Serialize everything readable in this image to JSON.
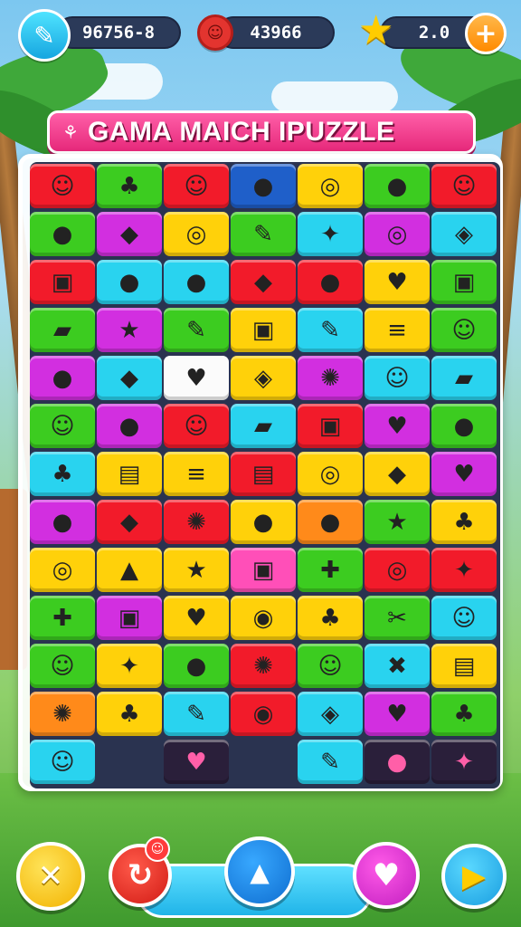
{
  "hud": {
    "score_text": "96756-8",
    "coins_text": "43966",
    "stars_text": "2.0",
    "add_label": "+"
  },
  "title": {
    "glyph": "⚘",
    "text": "GAMA MAICH IPUZZLE"
  },
  "colors": {
    "red": "#f21b2a",
    "green": "#3ccc20",
    "yellow": "#ffd10a",
    "cyan": "#29d3ef",
    "magenta": "#d22fe0",
    "pink": "#ff4fb8",
    "blue": "#1f5fc9",
    "orange": "#ff8a1a",
    "white": "#fbfbfb",
    "dark": "#2a1f3a"
  },
  "board": {
    "rows": [
      [
        {
          "c": "red",
          "i": "☺"
        },
        {
          "c": "green",
          "i": "♣"
        },
        {
          "c": "red",
          "i": "☺"
        },
        {
          "c": "blue",
          "i": "●"
        },
        {
          "c": "yellow",
          "i": "◎"
        },
        {
          "c": "green",
          "i": "●"
        },
        {
          "c": "red",
          "i": "☺"
        }
      ],
      [
        {
          "c": "green",
          "i": "●"
        },
        {
          "c": "magenta",
          "i": "◆"
        },
        {
          "c": "yellow",
          "i": "◎"
        },
        {
          "c": "green",
          "i": "✎"
        },
        {
          "c": "cyan",
          "i": "✦"
        },
        {
          "c": "magenta",
          "i": "◎"
        },
        {
          "c": "cyan",
          "i": "◈"
        }
      ],
      [
        {
          "c": "red",
          "i": "▣"
        },
        {
          "c": "cyan",
          "i": "●"
        },
        {
          "c": "cyan",
          "i": "●"
        },
        {
          "c": "red",
          "i": "◆"
        },
        {
          "c": "red",
          "i": "●"
        },
        {
          "c": "yellow",
          "i": "♥"
        },
        {
          "c": "green",
          "i": "▣"
        }
      ],
      [
        {
          "c": "green",
          "i": "▰"
        },
        {
          "c": "magenta",
          "i": "★"
        },
        {
          "c": "green",
          "i": "✎"
        },
        {
          "c": "yellow",
          "i": "▣"
        },
        {
          "c": "cyan",
          "i": "✎"
        },
        {
          "c": "yellow",
          "i": "≡"
        },
        {
          "c": "green",
          "i": "☺"
        }
      ],
      [
        {
          "c": "magenta",
          "i": "●"
        },
        {
          "c": "cyan",
          "i": "◆"
        },
        {
          "c": "white",
          "i": "♥"
        },
        {
          "c": "yellow",
          "i": "◈"
        },
        {
          "c": "magenta",
          "i": "✺"
        },
        {
          "c": "cyan",
          "i": "☺"
        },
        {
          "c": "cyan",
          "i": "▰"
        }
      ],
      [
        {
          "c": "green",
          "i": "☺"
        },
        {
          "c": "magenta",
          "i": "●"
        },
        {
          "c": "red",
          "i": "☺"
        },
        {
          "c": "cyan",
          "i": "▰"
        },
        {
          "c": "red",
          "i": "▣"
        },
        {
          "c": "magenta",
          "i": "♥"
        },
        {
          "c": "green",
          "i": "●"
        }
      ],
      [
        {
          "c": "cyan",
          "i": "♣"
        },
        {
          "c": "yellow",
          "i": "▤"
        },
        {
          "c": "yellow",
          "i": "≡"
        },
        {
          "c": "red",
          "i": "▤"
        },
        {
          "c": "yellow",
          "i": "◎"
        },
        {
          "c": "yellow",
          "i": "◆"
        },
        {
          "c": "magenta",
          "i": "♥"
        }
      ],
      [
        {
          "c": "magenta",
          "i": "●"
        },
        {
          "c": "red",
          "i": "◆"
        },
        {
          "c": "red",
          "i": "✺"
        },
        {
          "c": "yellow",
          "i": "●"
        },
        {
          "c": "orange",
          "i": "●"
        },
        {
          "c": "green",
          "i": "★"
        },
        {
          "c": "yellow",
          "i": "♣"
        }
      ],
      [
        {
          "c": "yellow",
          "i": "◎"
        },
        {
          "c": "yellow",
          "i": "▲"
        },
        {
          "c": "yellow",
          "i": "★"
        },
        {
          "c": "pink",
          "i": "▣"
        },
        {
          "c": "green",
          "i": "✚"
        },
        {
          "c": "red",
          "i": "◎"
        },
        {
          "c": "red",
          "i": "✦"
        }
      ],
      [
        {
          "c": "green",
          "i": "✚"
        },
        {
          "c": "magenta",
          "i": "▣"
        },
        {
          "c": "yellow",
          "i": "♥"
        },
        {
          "c": "yellow",
          "i": "◉"
        },
        {
          "c": "yellow",
          "i": "♣"
        },
        {
          "c": "green",
          "i": "✂"
        },
        {
          "c": "cyan",
          "i": "☺"
        }
      ],
      [
        {
          "c": "green",
          "i": "☺"
        },
        {
          "c": "yellow",
          "i": "✦"
        },
        {
          "c": "green",
          "i": "●"
        },
        {
          "c": "red",
          "i": "✺"
        },
        {
          "c": "green",
          "i": "☺"
        },
        {
          "c": "cyan",
          "i": "✖"
        },
        {
          "c": "yellow",
          "i": "▤"
        }
      ],
      [
        {
          "c": "orange",
          "i": "✺"
        },
        {
          "c": "yellow",
          "i": "♣"
        },
        {
          "c": "cyan",
          "i": "✎"
        },
        {
          "c": "red",
          "i": "◉"
        },
        {
          "c": "cyan",
          "i": "◈"
        },
        {
          "c": "magenta",
          "i": "♥"
        },
        {
          "c": "green",
          "i": "♣"
        }
      ],
      [
        {
          "c": "cyan",
          "i": "☺"
        },
        null,
        {
          "c": "dark",
          "i": "♥"
        },
        null,
        {
          "c": "cyan",
          "i": "✎"
        },
        {
          "c": "dark",
          "i": "●"
        },
        {
          "c": "dark",
          "i": "✦"
        }
      ]
    ]
  },
  "bottom": {
    "close_icon": "✕",
    "restart_icon": "↻",
    "badge_icon": "☺",
    "center_icon": "▲",
    "heart_icon": "♥",
    "play_icon": "▶"
  }
}
